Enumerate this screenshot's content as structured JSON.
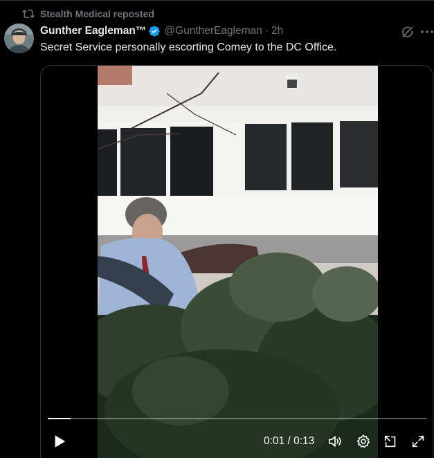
{
  "repost": {
    "label": "Stealth Medical reposted",
    "icon": "repost-icon"
  },
  "post": {
    "author_name": "Gunther Eagleman™",
    "verified": true,
    "handle": "@GuntherEagleman",
    "separator": "·",
    "time": "2h",
    "text": "Secret Service personally escorting Comey to the DC Office."
  },
  "video": {
    "current_time": "0:01",
    "time_separator": "/",
    "duration": "0:13",
    "progress_fraction": 0.06
  },
  "icons": {
    "grok": "grok-icon",
    "more": "more-icon",
    "play": "play-icon",
    "volume": "volume-icon",
    "settings": "gear-icon",
    "dock": "dock-icon",
    "fullscreen": "expand-icon"
  },
  "colors": {
    "background": "#000000",
    "text": "#e7e9ea",
    "muted": "#71767b",
    "verified": "#1d9bf0",
    "border": "#2f3336"
  }
}
